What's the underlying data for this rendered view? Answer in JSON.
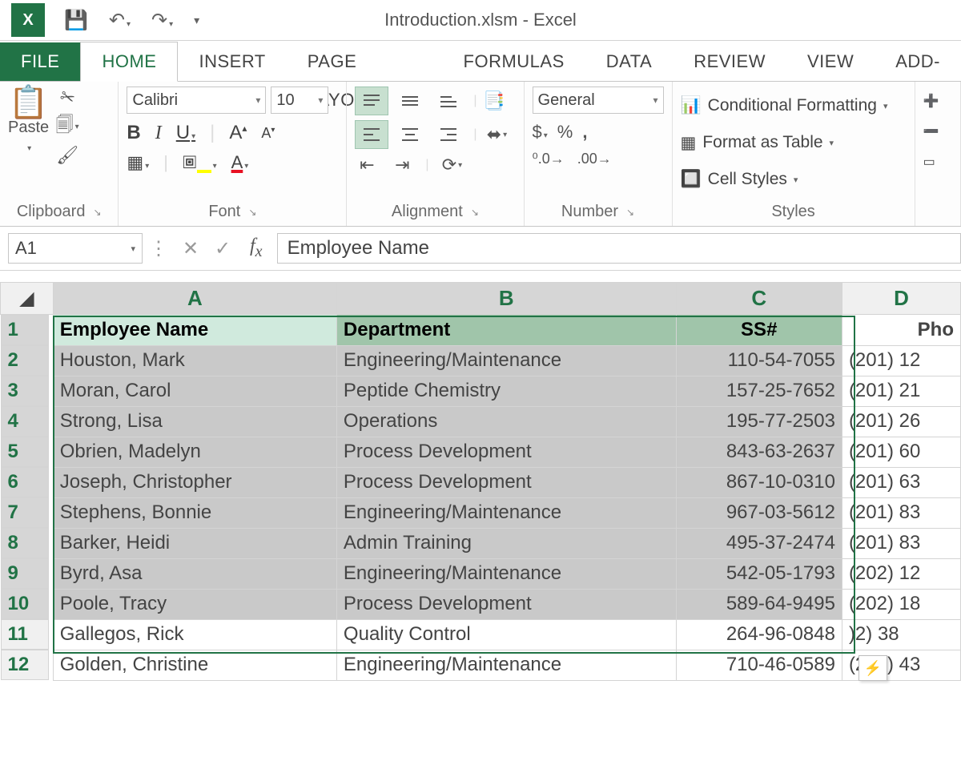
{
  "title": "Introduction.xlsm - Excel",
  "tabs": {
    "file": "FILE",
    "home": "HOME",
    "insert": "INSERT",
    "pagelayout": "PAGE LAYOUT",
    "formulas": "FORMULAS",
    "data": "DATA",
    "review": "REVIEW",
    "view": "VIEW",
    "addins": "ADD-"
  },
  "ribbon": {
    "paste": "Paste",
    "clipboard_label": "Clipboard",
    "font_name": "Calibri",
    "font_size": "10",
    "font_label": "Font",
    "alignment_label": "Alignment",
    "number_format": "General",
    "number_label": "Number",
    "cond_fmt": "Conditional Formatting",
    "fmt_table": "Format as Table",
    "cell_styles": "Cell Styles",
    "styles_label": "Styles"
  },
  "formula_bar": {
    "cell": "A1",
    "value": "Employee Name"
  },
  "columns": {
    "A": "A",
    "B": "B",
    "C": "C",
    "D": "D"
  },
  "headers": {
    "A": "Employee Name",
    "B": "Department",
    "C": "SS#",
    "D": "Pho"
  },
  "rows": [
    {
      "n": "1"
    },
    {
      "n": "2",
      "A": "Houston, Mark",
      "B": "Engineering/Maintenance",
      "C": "110-54-7055",
      "D": "(201) 12"
    },
    {
      "n": "3",
      "A": "Moran, Carol",
      "B": "Peptide Chemistry",
      "C": "157-25-7652",
      "D": "(201) 21"
    },
    {
      "n": "4",
      "A": "Strong, Lisa",
      "B": "Operations",
      "C": "195-77-2503",
      "D": "(201) 26"
    },
    {
      "n": "5",
      "A": "Obrien, Madelyn",
      "B": "Process Development",
      "C": "843-63-2637",
      "D": "(201) 60"
    },
    {
      "n": "6",
      "A": "Joseph, Christopher",
      "B": "Process Development",
      "C": "867-10-0310",
      "D": "(201) 63"
    },
    {
      "n": "7",
      "A": "Stephens, Bonnie",
      "B": "Engineering/Maintenance",
      "C": "967-03-5612",
      "D": "(201) 83"
    },
    {
      "n": "8",
      "A": "Barker, Heidi",
      "B": "Admin Training",
      "C": "495-37-2474",
      "D": "(201) 83"
    },
    {
      "n": "9",
      "A": "Byrd, Asa",
      "B": "Engineering/Maintenance",
      "C": "542-05-1793",
      "D": "(202) 12"
    },
    {
      "n": "10",
      "A": "Poole, Tracy",
      "B": "Process Development",
      "C": "589-64-9495",
      "D": "(202) 18"
    },
    {
      "n": "11",
      "A": "Gallegos, Rick",
      "B": "Quality Control",
      "C": "264-96-0848",
      "D": "    )2) 38"
    },
    {
      "n": "12",
      "A": "Golden, Christine",
      "B": "Engineering/Maintenance",
      "C": "710-46-0589",
      "D": "(202) 43"
    }
  ]
}
